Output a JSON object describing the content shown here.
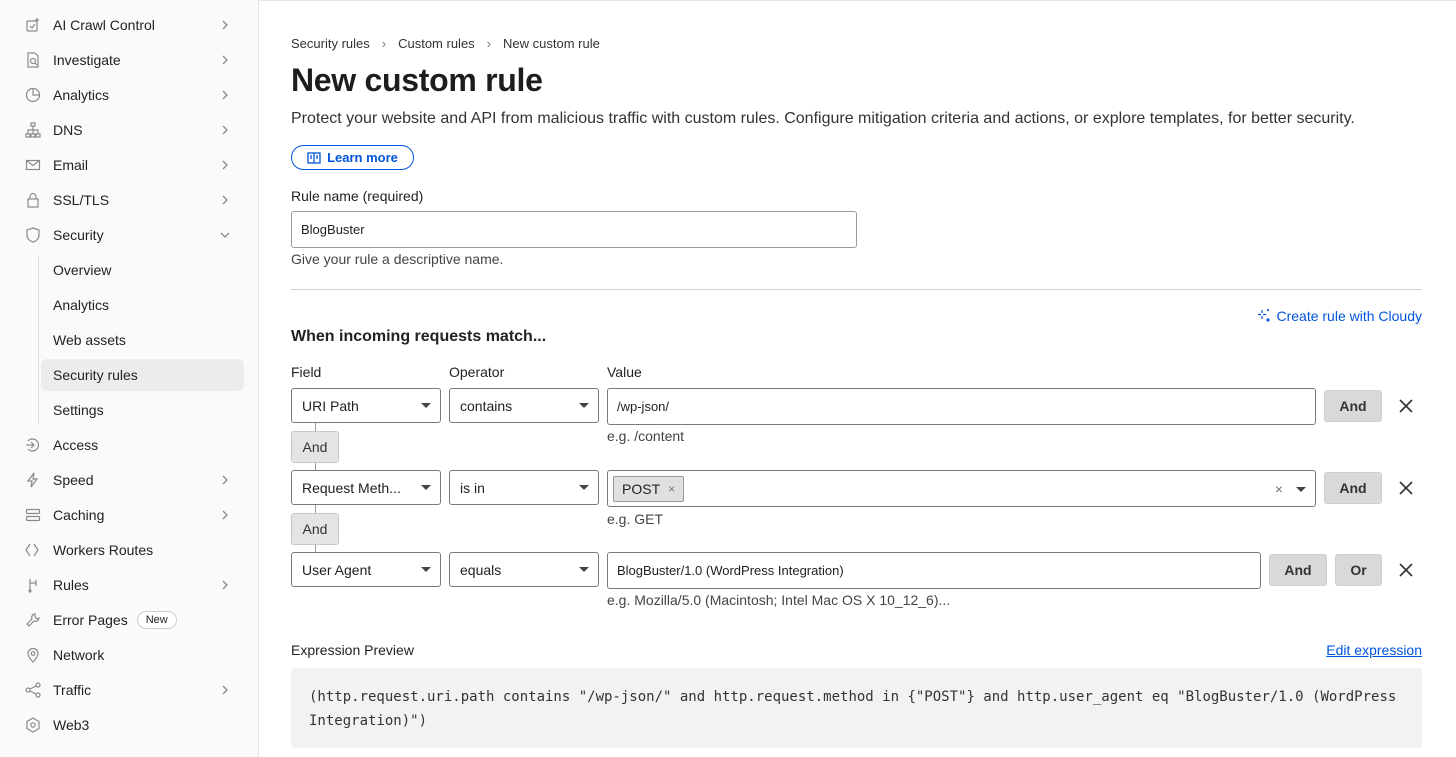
{
  "sidebar": {
    "items": [
      {
        "label": "AI Crawl Control",
        "icon": "ai-crawl-icon",
        "chevron": "right"
      },
      {
        "label": "Investigate",
        "icon": "investigate-icon",
        "chevron": "right"
      },
      {
        "label": "Analytics",
        "icon": "analytics-icon",
        "chevron": "right"
      },
      {
        "label": "DNS",
        "icon": "dns-icon",
        "chevron": "right"
      },
      {
        "label": "Email",
        "icon": "email-icon",
        "chevron": "right"
      },
      {
        "label": "SSL/TLS",
        "icon": "lock-icon",
        "chevron": "right"
      },
      {
        "label": "Security",
        "icon": "shield-icon",
        "chevron": "down"
      },
      {
        "label": "Overview"
      },
      {
        "label": "Analytics"
      },
      {
        "label": "Web assets"
      },
      {
        "label": "Security rules",
        "active": true
      },
      {
        "label": "Settings"
      },
      {
        "label": "Access",
        "icon": "access-icon"
      },
      {
        "label": "Speed",
        "icon": "lightning-icon",
        "chevron": "right"
      },
      {
        "label": "Caching",
        "icon": "caching-icon",
        "chevron": "right"
      },
      {
        "label": "Workers Routes",
        "icon": "workers-icon"
      },
      {
        "label": "Rules",
        "icon": "rules-icon",
        "chevron": "right"
      },
      {
        "label": "Error Pages",
        "icon": "wrench-icon",
        "badge": "New"
      },
      {
        "label": "Network",
        "icon": "location-pin-icon"
      },
      {
        "label": "Traffic",
        "icon": "traffic-icon",
        "chevron": "right"
      },
      {
        "label": "Web3",
        "icon": "web3-icon"
      }
    ]
  },
  "breadcrumb": [
    "Security rules",
    "Custom rules",
    "New custom rule"
  ],
  "page": {
    "title": "New custom rule",
    "description": "Protect your website and API from malicious traffic with custom rules. Configure mitigation criteria and actions, or explore templates, for better security.",
    "learn_more": "Learn more"
  },
  "rule_name": {
    "label": "Rule name (required)",
    "value": "BlogBuster",
    "help": "Give your rule a descriptive name."
  },
  "match": {
    "cloudy_link": "Create rule with Cloudy",
    "heading": "When incoming requests match...",
    "columns": {
      "field": "Field",
      "operator": "Operator",
      "value": "Value"
    },
    "connector": "And",
    "rows": [
      {
        "field": "URI Path",
        "operator": "contains",
        "value": "/wp-json/",
        "hint": "e.g. /content",
        "buttons": [
          "And"
        ]
      },
      {
        "field": "Request Meth...",
        "operator": "is in",
        "tag": "POST",
        "hint": "e.g. GET",
        "buttons": [
          "And"
        ]
      },
      {
        "field": "User Agent",
        "operator": "equals",
        "value": "BlogBuster/1.0 (WordPress Integration)",
        "hint": "e.g. Mozilla/5.0 (Macintosh; Intel Mac OS X 10_12_6)...",
        "buttons": [
          "And",
          "Or"
        ]
      }
    ]
  },
  "expression": {
    "label": "Expression Preview",
    "edit_link": "Edit expression",
    "text": "(http.request.uri.path contains \"/wp-json/\" and http.request.method in {\"POST\"} and http.user_agent eq \"BlogBuster/1.0 (WordPress Integration)\")"
  },
  "colors": {
    "accent": "#0055dc",
    "sidebar_bg": "#fafafa",
    "expr_bg": "#f2f2f2"
  }
}
